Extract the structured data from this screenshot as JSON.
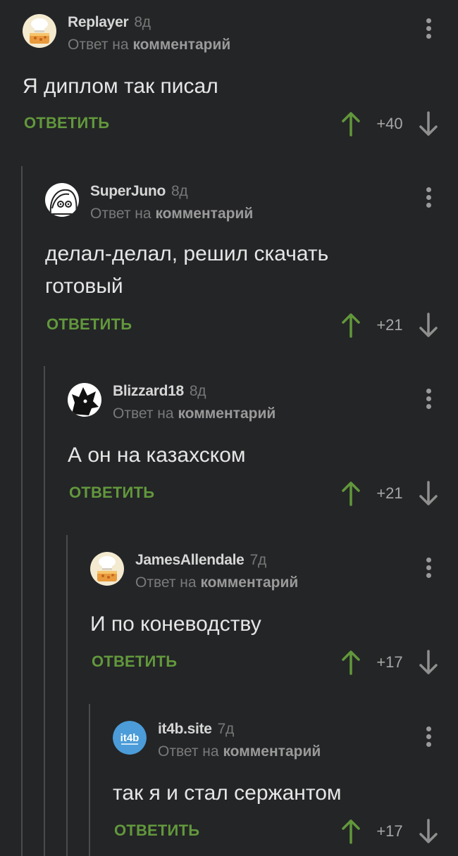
{
  "colors": {
    "background": "#242527",
    "accent_green": "#62983c",
    "thread_line": "#4a4b4e"
  },
  "comments": [
    {
      "author": "Replayer",
      "age": "8д",
      "reply_prefix": "Ответ на",
      "reply_target": "комментарий",
      "text_lines": [
        "Я диплом так писал"
      ],
      "reply_label": "ОТВЕТИТЬ",
      "score": "+40",
      "avatar_icon": "chef-hat-cake-avatar-icon"
    },
    {
      "author": "SuperJuno",
      "age": "8д",
      "reply_prefix": "Ответ на",
      "reply_target": "комментарий",
      "text_lines": [
        "делал-делал, решил скачать",
        "готовый"
      ],
      "reply_label": "ОТВЕТИТЬ",
      "score": "+21",
      "avatar_icon": "cartoon-face-avatar-icon"
    },
    {
      "author": "Blizzard18",
      "age": "8д",
      "reply_prefix": "Ответ на",
      "reply_target": "комментарий",
      "text_lines": [
        "А он на казахском"
      ],
      "reply_label": "ОТВЕТИТЬ",
      "score": "+21",
      "avatar_icon": "black-silhouette-avatar-icon"
    },
    {
      "author": "JamesAllendale",
      "age": "7д",
      "reply_prefix": "Ответ на",
      "reply_target": "комментарий",
      "text_lines": [
        "И по коневодству"
      ],
      "reply_label": "ОТВЕТИТЬ",
      "score": "+17",
      "avatar_icon": "chef-hat-cake-avatar-icon"
    },
    {
      "author": "it4b.site",
      "age": "7д",
      "reply_prefix": "Ответ на",
      "reply_target": "комментарий",
      "text_lines": [
        "так я и стал сержантом"
      ],
      "reply_label": "ОТВЕТИТЬ",
      "score": "+17",
      "avatar_icon": "it4b-logo-avatar-icon",
      "avatar_logo_text": "it4b"
    }
  ]
}
